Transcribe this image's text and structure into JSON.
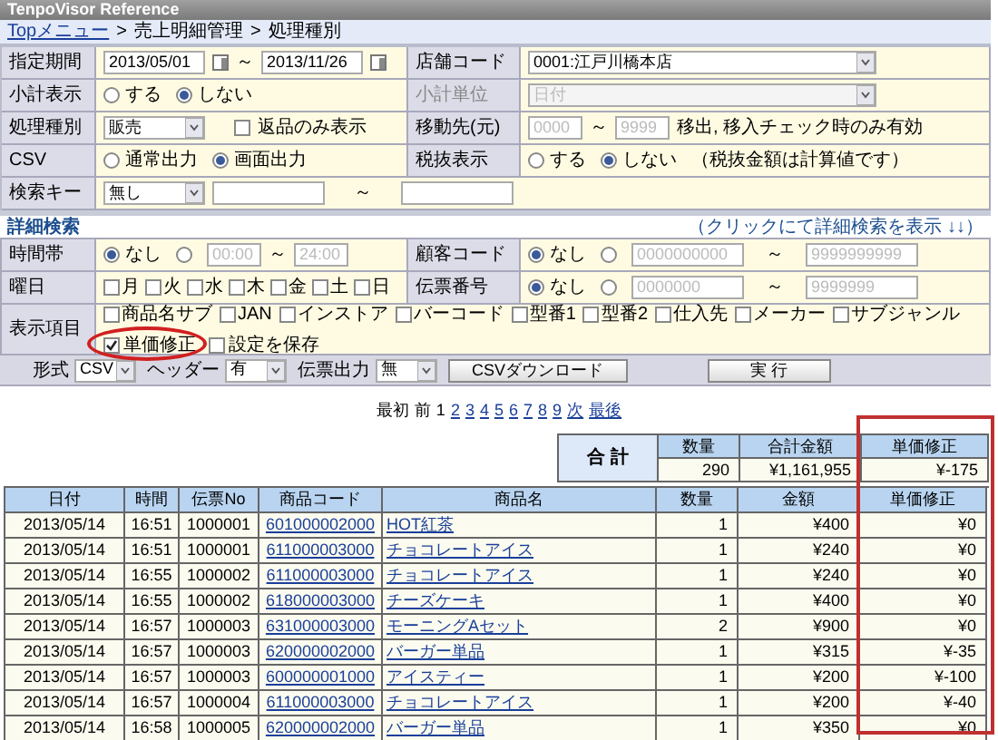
{
  "window": {
    "title": "TenpoVisor Reference"
  },
  "breadcrumb": {
    "link": "Topメニュー",
    "separator": ">",
    "items": [
      "売上明細管理",
      "処理種別"
    ]
  },
  "form": {
    "period": {
      "label": "指定期間",
      "from": "2013/05/01",
      "sep": "～",
      "to": "2013/11/26"
    },
    "store": {
      "label": "店舗コード",
      "value": "0001:江戸川橋本店"
    },
    "subtotal": {
      "label": "小計表示",
      "options": [
        {
          "label": "する",
          "selected": false
        },
        {
          "label": "しない",
          "selected": true
        }
      ]
    },
    "subtotal_unit": {
      "label": "小計単位",
      "value": "日付",
      "disabled": true
    },
    "process_type": {
      "label": "処理種別",
      "value": "販売",
      "checkbox": {
        "label": "返品のみ表示",
        "checked": false
      }
    },
    "move_from": {
      "label": "移動先(元)",
      "from_placeholder": "0000",
      "sep": "～",
      "to_placeholder": "9999",
      "note": "移出, 移入チェック時のみ有効"
    },
    "csv": {
      "label": "CSV",
      "options": [
        {
          "label": "通常出力",
          "selected": false
        },
        {
          "label": "画面出力",
          "selected": true
        }
      ]
    },
    "tax": {
      "label": "税抜表示",
      "options": [
        {
          "label": "する",
          "selected": false
        },
        {
          "label": "しない",
          "selected": true
        }
      ],
      "note": "（税抜金額は計算値です）"
    },
    "search_key": {
      "label": "検索キー",
      "value": "無し",
      "sep": "～"
    }
  },
  "detail": {
    "title": "詳細検索",
    "toggle": "（クリックにて詳細検索を表示 ↓↓）",
    "time": {
      "label": "時間帯",
      "options": [
        {
          "label": "なし",
          "selected": true
        },
        {
          "selected": false
        }
      ],
      "from_placeholder": "00:00",
      "sep": "～",
      "to_placeholder": "24:00"
    },
    "customer": {
      "label": "顧客コード",
      "options": [
        {
          "label": "なし",
          "selected": true
        },
        {
          "selected": false
        }
      ],
      "from_placeholder": "0000000000",
      "sep": "～",
      "to_placeholder": "9999999999"
    },
    "weekday": {
      "label": "曜日",
      "days": [
        {
          "label": "月",
          "checked": false
        },
        {
          "label": "火",
          "checked": false
        },
        {
          "label": "水",
          "checked": false
        },
        {
          "label": "木",
          "checked": false
        },
        {
          "label": "金",
          "checked": false
        },
        {
          "label": "土",
          "checked": false
        },
        {
          "label": "日",
          "checked": false
        }
      ]
    },
    "slip": {
      "label": "伝票番号",
      "options": [
        {
          "label": "なし",
          "selected": true
        },
        {
          "selected": false
        }
      ],
      "from_placeholder": "0000000",
      "sep": "～",
      "to_placeholder": "9999999"
    },
    "display": {
      "label": "表示項目",
      "items": [
        {
          "label": "商品名サブ",
          "checked": false
        },
        {
          "label": "JAN",
          "checked": false
        },
        {
          "label": "インストア",
          "checked": false
        },
        {
          "label": "バーコード",
          "checked": false
        },
        {
          "label": "型番1",
          "checked": false
        },
        {
          "label": "型番2",
          "checked": false
        },
        {
          "label": "仕入先",
          "checked": false
        },
        {
          "label": "メーカー",
          "checked": false
        },
        {
          "label": "サブジャンル",
          "checked": false
        }
      ],
      "items2": [
        {
          "label": "単価修正",
          "checked": true
        },
        {
          "label": "設定を保存",
          "checked": false
        }
      ]
    }
  },
  "toolbar": {
    "selects": [
      {
        "label": "形式",
        "value": "CSV"
      },
      {
        "label": "ヘッダー",
        "value": "有"
      },
      {
        "label": "伝票出力",
        "value": "無"
      }
    ],
    "download": "CSVダウンロード",
    "run": "実 行"
  },
  "pagination": [
    {
      "label": "最初",
      "kind": "text"
    },
    {
      "label": "前",
      "kind": "text"
    },
    {
      "label": "1",
      "kind": "current"
    },
    {
      "label": "2",
      "kind": "link"
    },
    {
      "label": "3",
      "kind": "link"
    },
    {
      "label": "4",
      "kind": "link"
    },
    {
      "label": "5",
      "kind": "link"
    },
    {
      "label": "6",
      "kind": "link"
    },
    {
      "label": "7",
      "kind": "link"
    },
    {
      "label": "8",
      "kind": "link"
    },
    {
      "label": "9",
      "kind": "link"
    },
    {
      "label": "次",
      "kind": "link"
    },
    {
      "label": "最後",
      "kind": "link"
    }
  ],
  "summary": {
    "label": "合 計",
    "columns": [
      "数量",
      "合計金額",
      "単価修正"
    ],
    "values": [
      "290",
      "¥1,161,955",
      "¥-175"
    ]
  },
  "table": {
    "columns": [
      "日付",
      "時間",
      "伝票No",
      "商品コード",
      "商品名",
      "数量",
      "金額",
      "単価修正"
    ],
    "rows": [
      [
        "2013/05/14",
        "16:51",
        "1000001",
        "601000002000",
        "HOT紅茶",
        "1",
        "¥400",
        "¥0"
      ],
      [
        "2013/05/14",
        "16:51",
        "1000001",
        "611000003000",
        "チョコレートアイス",
        "1",
        "¥240",
        "¥0"
      ],
      [
        "2013/05/14",
        "16:55",
        "1000002",
        "611000003000",
        "チョコレートアイス",
        "1",
        "¥240",
        "¥0"
      ],
      [
        "2013/05/14",
        "16:55",
        "1000002",
        "618000003000",
        "チーズケーキ",
        "1",
        "¥400",
        "¥0"
      ],
      [
        "2013/05/14",
        "16:57",
        "1000003",
        "631000003000",
        "モーニングAセット",
        "2",
        "¥900",
        "¥0"
      ],
      [
        "2013/05/14",
        "16:57",
        "1000003",
        "620000002000",
        "バーガー単品",
        "1",
        "¥315",
        "¥-35"
      ],
      [
        "2013/05/14",
        "16:57",
        "1000003",
        "600000001000",
        "アイスティー",
        "1",
        "¥200",
        "¥-100"
      ],
      [
        "2013/05/14",
        "16:57",
        "1000004",
        "611000003000",
        "チョコレートアイス",
        "1",
        "¥200",
        "¥-40"
      ],
      [
        "2013/05/14",
        "16:58",
        "1000005",
        "620000002000",
        "バーガー単品",
        "1",
        "¥350",
        "¥0"
      ]
    ]
  },
  "annotations": [
    {
      "kind": "ellipse"
    },
    {
      "kind": "frame"
    }
  ]
}
